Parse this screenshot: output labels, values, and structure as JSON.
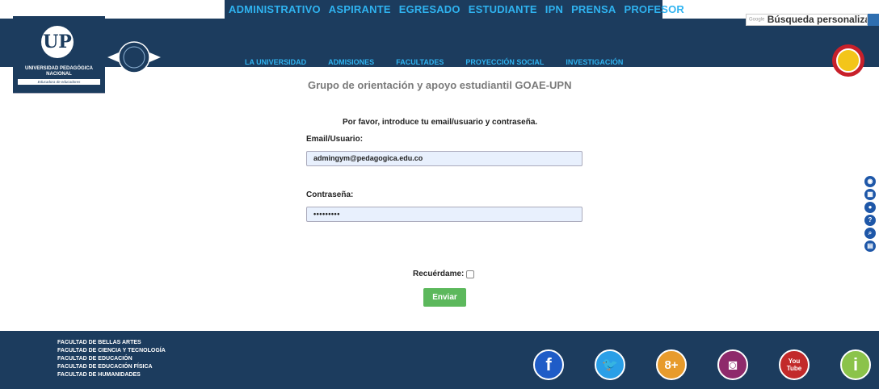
{
  "top_nav": [
    "ADMINISTRATIVO",
    "ASPIRANTE",
    "EGRESADO",
    "ESTUDIANTE",
    "IPN",
    "PRENSA",
    "PROFESOR"
  ],
  "main_nav": [
    "LA UNIVERSIDAD",
    "ADMISIONES",
    "FACULTADES",
    "PROYECCIÓN SOCIAL",
    "INVESTIGACIÓN"
  ],
  "logo": {
    "initials": "UP",
    "name_line1": "UNIVERSIDAD PEDAGÓGICA",
    "name_line2": "NACIONAL",
    "motto": "Educadora de educadores"
  },
  "search": {
    "google_tag": "Google",
    "placeholder": "Búsqueda personalizada"
  },
  "form": {
    "title": "Grupo de orientación y apoyo estudiantil GOAE-UPN",
    "prompt": "Por favor, introduce tu email/usuario y contraseña.",
    "email_label": "Email/Usuario:",
    "email_value": "admingym@pedagogica.edu.co",
    "password_label": "Contraseña:",
    "password_value": "•••••••••",
    "remember_label": "Recuérdame:",
    "submit_label": "Enviar"
  },
  "accessibility_tools": [
    "chat-icon",
    "keyboard-icon",
    "microphone-icon",
    "help-icon",
    "zoom-icon",
    "pdf-icon"
  ],
  "footer": {
    "faculties": [
      "FACULTAD DE BELLAS ARTES",
      "FACULTAD DE CIENCIA Y TECNOLOGÍA",
      "FACULTAD DE EDUCACIÓN",
      "FACULTAD DE EDUCACIÓN FÍSICA",
      "FACULTAD DE HUMANIDADES"
    ],
    "social": [
      {
        "name": "facebook-icon",
        "glyph": "f",
        "color": "#1f5cc7"
      },
      {
        "name": "twitter-icon",
        "glyph": "🐦",
        "color": "#2a9fe7"
      },
      {
        "name": "google-plus-icon",
        "glyph": "8+",
        "color": "#e79b2c"
      },
      {
        "name": "instagram-icon",
        "glyph": "◙",
        "color": "#8e2a6b"
      },
      {
        "name": "youtube-icon",
        "glyph": "You Tube",
        "color": "#c22a2a"
      },
      {
        "name": "info-icon",
        "glyph": "i",
        "color": "#8bc34a"
      }
    ]
  },
  "colors": {
    "navy": "#1c3c5e",
    "link_blue": "#2fb3f0",
    "submit_green": "#5cb85c",
    "tool_blue": "#1e57a8"
  }
}
